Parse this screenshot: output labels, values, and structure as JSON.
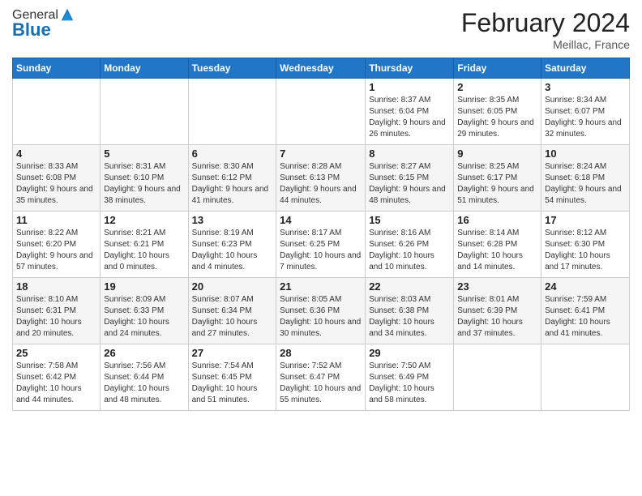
{
  "logo": {
    "general": "General",
    "blue": "Blue"
  },
  "header": {
    "month": "February 2024",
    "location": "Meillac, France"
  },
  "weekdays": [
    "Sunday",
    "Monday",
    "Tuesday",
    "Wednesday",
    "Thursday",
    "Friday",
    "Saturday"
  ],
  "rows": [
    [
      {
        "day": "",
        "info": ""
      },
      {
        "day": "",
        "info": ""
      },
      {
        "day": "",
        "info": ""
      },
      {
        "day": "",
        "info": ""
      },
      {
        "day": "1",
        "info": "Sunrise: 8:37 AM\nSunset: 6:04 PM\nDaylight: 9 hours and 26 minutes."
      },
      {
        "day": "2",
        "info": "Sunrise: 8:35 AM\nSunset: 6:05 PM\nDaylight: 9 hours and 29 minutes."
      },
      {
        "day": "3",
        "info": "Sunrise: 8:34 AM\nSunset: 6:07 PM\nDaylight: 9 hours and 32 minutes."
      }
    ],
    [
      {
        "day": "4",
        "info": "Sunrise: 8:33 AM\nSunset: 6:08 PM\nDaylight: 9 hours and 35 minutes."
      },
      {
        "day": "5",
        "info": "Sunrise: 8:31 AM\nSunset: 6:10 PM\nDaylight: 9 hours and 38 minutes."
      },
      {
        "day": "6",
        "info": "Sunrise: 8:30 AM\nSunset: 6:12 PM\nDaylight: 9 hours and 41 minutes."
      },
      {
        "day": "7",
        "info": "Sunrise: 8:28 AM\nSunset: 6:13 PM\nDaylight: 9 hours and 44 minutes."
      },
      {
        "day": "8",
        "info": "Sunrise: 8:27 AM\nSunset: 6:15 PM\nDaylight: 9 hours and 48 minutes."
      },
      {
        "day": "9",
        "info": "Sunrise: 8:25 AM\nSunset: 6:17 PM\nDaylight: 9 hours and 51 minutes."
      },
      {
        "day": "10",
        "info": "Sunrise: 8:24 AM\nSunset: 6:18 PM\nDaylight: 9 hours and 54 minutes."
      }
    ],
    [
      {
        "day": "11",
        "info": "Sunrise: 8:22 AM\nSunset: 6:20 PM\nDaylight: 9 hours and 57 minutes."
      },
      {
        "day": "12",
        "info": "Sunrise: 8:21 AM\nSunset: 6:21 PM\nDaylight: 10 hours and 0 minutes."
      },
      {
        "day": "13",
        "info": "Sunrise: 8:19 AM\nSunset: 6:23 PM\nDaylight: 10 hours and 4 minutes."
      },
      {
        "day": "14",
        "info": "Sunrise: 8:17 AM\nSunset: 6:25 PM\nDaylight: 10 hours and 7 minutes."
      },
      {
        "day": "15",
        "info": "Sunrise: 8:16 AM\nSunset: 6:26 PM\nDaylight: 10 hours and 10 minutes."
      },
      {
        "day": "16",
        "info": "Sunrise: 8:14 AM\nSunset: 6:28 PM\nDaylight: 10 hours and 14 minutes."
      },
      {
        "day": "17",
        "info": "Sunrise: 8:12 AM\nSunset: 6:30 PM\nDaylight: 10 hours and 17 minutes."
      }
    ],
    [
      {
        "day": "18",
        "info": "Sunrise: 8:10 AM\nSunset: 6:31 PM\nDaylight: 10 hours and 20 minutes."
      },
      {
        "day": "19",
        "info": "Sunrise: 8:09 AM\nSunset: 6:33 PM\nDaylight: 10 hours and 24 minutes."
      },
      {
        "day": "20",
        "info": "Sunrise: 8:07 AM\nSunset: 6:34 PM\nDaylight: 10 hours and 27 minutes."
      },
      {
        "day": "21",
        "info": "Sunrise: 8:05 AM\nSunset: 6:36 PM\nDaylight: 10 hours and 30 minutes."
      },
      {
        "day": "22",
        "info": "Sunrise: 8:03 AM\nSunset: 6:38 PM\nDaylight: 10 hours and 34 minutes."
      },
      {
        "day": "23",
        "info": "Sunrise: 8:01 AM\nSunset: 6:39 PM\nDaylight: 10 hours and 37 minutes."
      },
      {
        "day": "24",
        "info": "Sunrise: 7:59 AM\nSunset: 6:41 PM\nDaylight: 10 hours and 41 minutes."
      }
    ],
    [
      {
        "day": "25",
        "info": "Sunrise: 7:58 AM\nSunset: 6:42 PM\nDaylight: 10 hours and 44 minutes."
      },
      {
        "day": "26",
        "info": "Sunrise: 7:56 AM\nSunset: 6:44 PM\nDaylight: 10 hours and 48 minutes."
      },
      {
        "day": "27",
        "info": "Sunrise: 7:54 AM\nSunset: 6:45 PM\nDaylight: 10 hours and 51 minutes."
      },
      {
        "day": "28",
        "info": "Sunrise: 7:52 AM\nSunset: 6:47 PM\nDaylight: 10 hours and 55 minutes."
      },
      {
        "day": "29",
        "info": "Sunrise: 7:50 AM\nSunset: 6:49 PM\nDaylight: 10 hours and 58 minutes."
      },
      {
        "day": "",
        "info": ""
      },
      {
        "day": "",
        "info": ""
      }
    ]
  ]
}
